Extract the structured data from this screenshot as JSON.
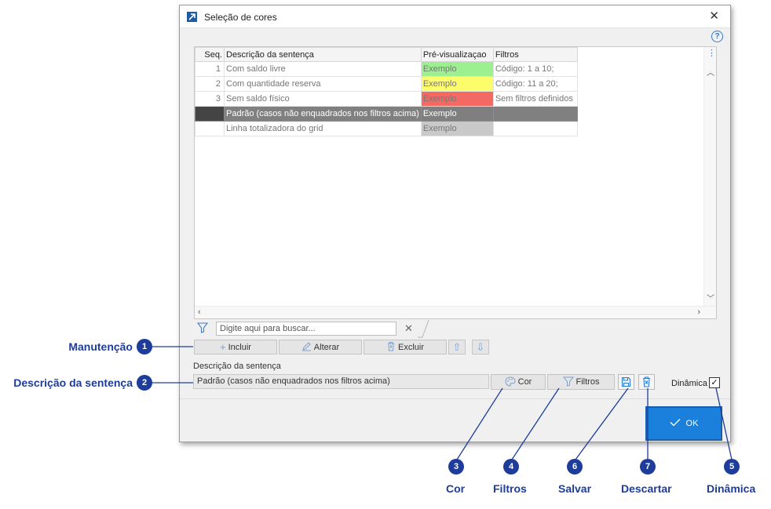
{
  "window": {
    "title": "Seleção de cores",
    "help": "?"
  },
  "grid": {
    "columns": [
      "Seq.",
      "Descrição da sentença",
      "Pré-visualizaçao",
      "Filtros"
    ],
    "rows": [
      {
        "seq": "1",
        "desc": "Com saldo livre",
        "preview": "Exemplo",
        "preview_color": "#9cf08f",
        "filters": "Código: 1 a 10;"
      },
      {
        "seq": "2",
        "desc": "Com quantidade reserva",
        "preview": "Exemplo",
        "preview_color": "#fdfc6a",
        "filters": "Código: 11 a 20;"
      },
      {
        "seq": "3",
        "desc": "Sem saldo físico",
        "preview": "Exemplo",
        "preview_color": "#f46a63",
        "filters": "Sem filtros definidos"
      },
      {
        "seq": "",
        "desc": "Padrão (casos não enquadrados nos filtros acima)",
        "preview": "Exemplo",
        "preview_color": "#7f7f7f",
        "filters": ""
      },
      {
        "seq": "",
        "desc": "Linha totalizadora do grid",
        "preview": "Exemplo",
        "preview_color": "#c9c9c9",
        "filters": ""
      }
    ]
  },
  "search": {
    "placeholder": "Digite aqui para buscar..."
  },
  "toolbar": {
    "incluir": "Incluir",
    "alterar": "Alterar",
    "excluir": "Excluir"
  },
  "description": {
    "label": "Descrição da sentença",
    "value": "Padrão (casos não enquadrados nos filtros acima)",
    "cor_label": "Cor",
    "filtros_label": "Filtros",
    "dinamica_label": "Dinâmica",
    "dinamica_checked": true
  },
  "ok_label": "OK",
  "callouts": [
    {
      "num": "1",
      "label": "Manutenção"
    },
    {
      "num": "2",
      "label": "Descrição da sentença"
    },
    {
      "num": "3",
      "label": "Cor"
    },
    {
      "num": "4",
      "label": "Filtros"
    },
    {
      "num": "6",
      "label": "Salvar"
    },
    {
      "num": "7",
      "label": "Descartar"
    },
    {
      "num": "5",
      "label": "Dinâmica"
    }
  ],
  "colors": {
    "accent": "#1a80dc",
    "callout": "#1e3d9a",
    "selected_row": "#808080"
  }
}
